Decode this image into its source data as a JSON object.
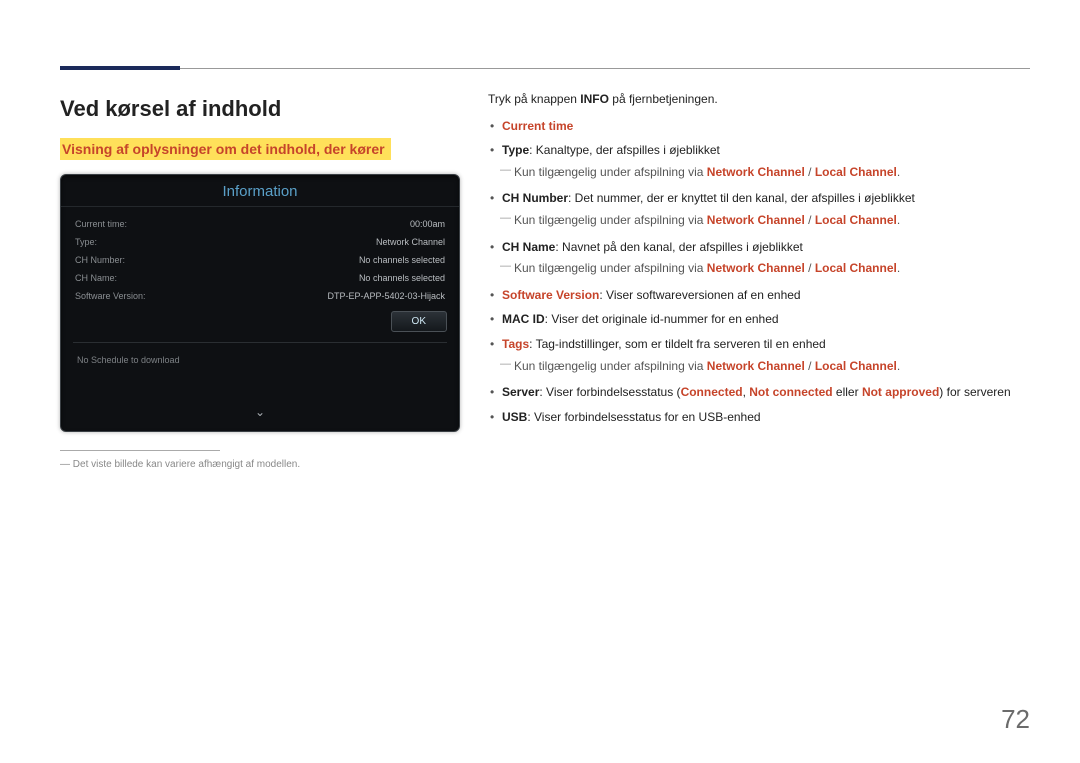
{
  "page_number": "72",
  "heading": "Ved kørsel af indhold",
  "subheading": "Visning af oplysninger om det indhold, der kører",
  "panel": {
    "title": "Information",
    "rows": [
      {
        "label": "Current time:",
        "value": "00:00am"
      },
      {
        "label": "Type:",
        "value": "Network Channel"
      },
      {
        "label": "CH Number:",
        "value": "No channels selected"
      },
      {
        "label": "CH Name:",
        "value": "No channels selected"
      },
      {
        "label": "Software Version:",
        "value": "DTP-EP-APP-5402-03-Hijack"
      }
    ],
    "ok": "OK",
    "schedule": "No Schedule to download"
  },
  "footnote": "Det viste billede kan variere afhængigt af modellen.",
  "intro_pre": "Tryk på knappen ",
  "intro_bold": "INFO",
  "intro_post": " på fjernbetjeningen.",
  "items": {
    "current_time": "Current time",
    "type_bold": "Type",
    "type_text": ": Kanaltype, der afspilles i øjeblikket",
    "avail_pre": "Kun tilgængelig under afspilning via ",
    "nc": "Network Channel",
    "sep": " / ",
    "lc": "Local Channel",
    "period": ".",
    "chnum_bold": "CH Number",
    "chnum_text": ": Det nummer, der er knyttet til den kanal, der afspilles i øjeblikket",
    "chname_bold": "CH Name",
    "chname_text": ": Navnet på den kanal, der afspilles i øjeblikket",
    "sw_bold": "Software Version",
    "sw_text": ": Viser softwareversionen af en enhed",
    "mac_bold": "MAC ID",
    "mac_text": ": Viser det originale id-nummer for en enhed",
    "tags_bold": "Tags",
    "tags_text": ": Tag-indstillinger, som er tildelt fra serveren til en enhed",
    "server_bold": "Server",
    "server_pre": ": Viser forbindelsesstatus (",
    "server_c": "Connected",
    "server_comma": ", ",
    "server_nc": "Not connected",
    "server_or": " eller ",
    "server_na": "Not approved",
    "server_post": ") for serveren",
    "usb_bold": "USB",
    "usb_text": ": Viser forbindelsesstatus for en USB-enhed"
  }
}
